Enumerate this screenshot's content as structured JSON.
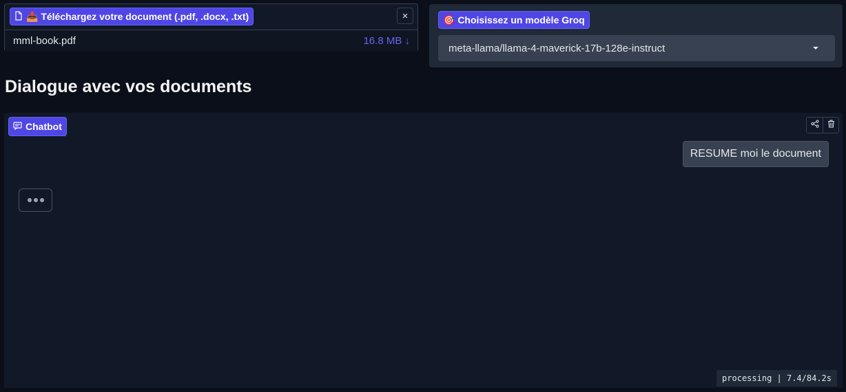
{
  "upload": {
    "label": "📥 Téléchargez votre document (.pdf, .docx, .txt)",
    "label_icon": "file-icon",
    "close_icon": "×",
    "file_name": "mml-book.pdf",
    "file_size": "16.8 MB ↓"
  },
  "model": {
    "label": "🎯 Choisissez un modèle Groq",
    "selected": "meta-llama/llama-4-maverick-17b-128e-instruct"
  },
  "page_title": "Dialogue avec vos documents",
  "chatbot": {
    "label": "Chatbot",
    "user_message": "RESUME moi le document",
    "status": "processing | 7.4/84.2s"
  },
  "colors": {
    "accent": "#4f46e5",
    "background": "#0b0f19",
    "panel": "#111827"
  }
}
